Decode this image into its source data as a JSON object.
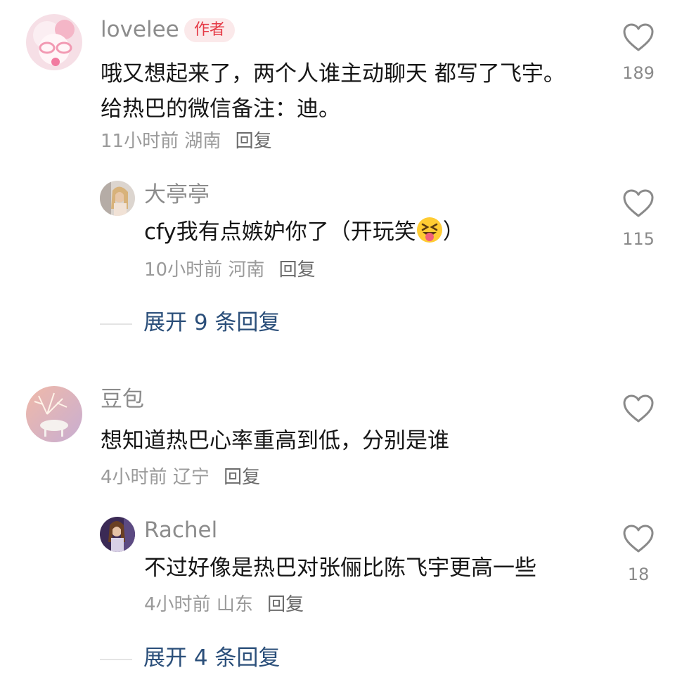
{
  "comments": [
    {
      "username": "lovelee",
      "badge": "作者",
      "text": "哦又想起来了，两个人谁主动聊天 都写了飞宇。给热巴的微信备注：迪。",
      "time": "11小时前",
      "location": "湖南",
      "reply_label": "回复",
      "likes": "189",
      "replies": [
        {
          "username": "大亭亭",
          "text": "cfy我有点嫉妒你了（开玩笑",
          "text_suffix": "）",
          "emoji": "squinting-face-with-tongue",
          "time": "10小时前",
          "location": "河南",
          "reply_label": "回复",
          "likes": "115"
        }
      ],
      "expand_label": "展开 9 条回复"
    },
    {
      "username": "豆包",
      "text": "想知道热巴心率重高到低，分别是谁",
      "time": "4小时前",
      "location": "辽宁",
      "reply_label": "回复",
      "likes": "",
      "replies": [
        {
          "username": "Rachel",
          "text": "不过好像是热巴对张俪比陈飞宇更高一些",
          "time": "4小时前",
          "location": "山东",
          "reply_label": "回复",
          "likes": "18"
        }
      ],
      "expand_label": "展开 4 条回复"
    }
  ],
  "colors": {
    "username": "#8c8c8c",
    "text": "#161616",
    "meta": "#9a9a9a",
    "expand": "#2b4f7a",
    "badge_bg": "#fbe9ea",
    "badge_fg": "#e53945"
  }
}
